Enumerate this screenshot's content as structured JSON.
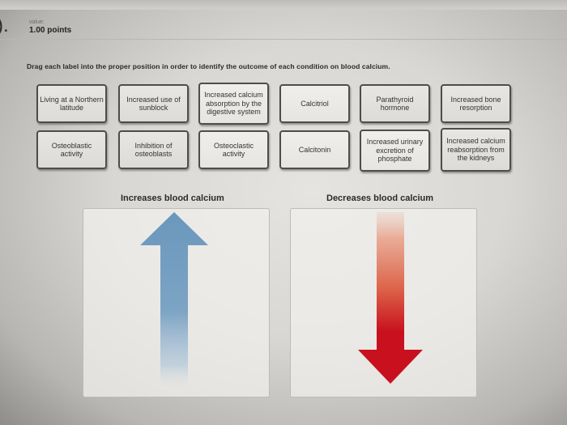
{
  "question": {
    "number_fragment": ").",
    "value_label": "value:",
    "value_points": "1.00 points",
    "instructions": "Drag each label into the proper position in order to identify the outcome of each condition on blood calcium."
  },
  "labels_row1": [
    "Living at a Northern latitude",
    "Increased use of sunblock",
    "Increased calcium absorption by the digestive system",
    "Calcitriol",
    "Parathyroid hormone",
    "Increased bone resorption"
  ],
  "labels_row2": [
    "Osteoblastic activity",
    "Inhibition of osteoblasts",
    "Osteoclastic activity",
    "Calcitonin",
    "Increased urinary excretion of phosphate",
    "Increased calcium reabsorption from the kidneys"
  ],
  "drop_zones": [
    {
      "title": "Increases blood calcium",
      "arrow_direction": "up",
      "arrow_color": "#6a97bd"
    },
    {
      "title": "Decreases blood calcium",
      "arrow_direction": "down",
      "arrow_color": "#c8101e"
    }
  ]
}
